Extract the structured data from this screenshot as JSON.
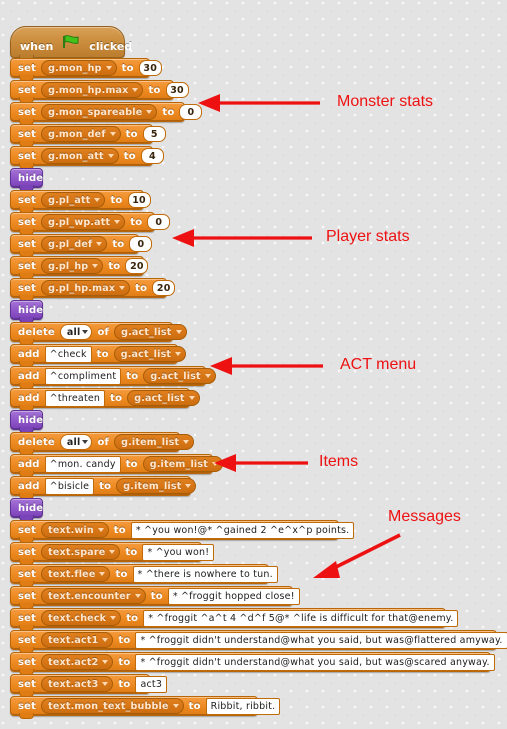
{
  "editor": {
    "background_color": "#e3e3e3",
    "annotation_color": "#ee1111",
    "data_block_color": "#ee8a22",
    "looks_block_color": "#8e55c8",
    "hat_block_color": "#c98b3b"
  },
  "hat": {
    "when_label": "when",
    "flag_label": "green-flag",
    "clicked_label": "clicked"
  },
  "keywords": {
    "set": "set",
    "to": "to",
    "hide": "hide",
    "delete": "delete",
    "of": "of",
    "add": "add"
  },
  "scripts": {
    "monster_stats": [
      {
        "op": "set",
        "variable": "g.mon_hp",
        "value": "30"
      },
      {
        "op": "set",
        "variable": "g.mon_hp.max",
        "value": "30"
      },
      {
        "op": "set",
        "variable": "g.mon_spareable",
        "value": "0"
      },
      {
        "op": "set",
        "variable": "g.mon_def",
        "value": "5"
      },
      {
        "op": "set",
        "variable": "g.mon_att",
        "value": "4"
      }
    ],
    "hide_1": "hide",
    "player_stats": [
      {
        "op": "set",
        "variable": "g.pl_att",
        "value": "10"
      },
      {
        "op": "set",
        "variable": "g.pl_wp.att",
        "value": "0"
      },
      {
        "op": "set",
        "variable": "g.pl_def",
        "value": "0"
      },
      {
        "op": "set",
        "variable": "g.pl_hp",
        "value": "20"
      },
      {
        "op": "set",
        "variable": "g.pl_hp.max",
        "value": "20"
      }
    ],
    "hide_2": "hide",
    "act_menu": [
      {
        "op": "delete",
        "selection": "all",
        "list": "g.act_list"
      },
      {
        "op": "add",
        "item": "^check",
        "list": "g.act_list"
      },
      {
        "op": "add",
        "item": "^compliment",
        "list": "g.act_list"
      },
      {
        "op": "add",
        "item": "^threaten",
        "list": "g.act_list"
      }
    ],
    "hide_3": "hide",
    "items": [
      {
        "op": "delete",
        "selection": "all",
        "list": "g.item_list"
      },
      {
        "op": "add",
        "item": "^mon. candy",
        "list": "g.item_list"
      },
      {
        "op": "add",
        "item": "^bisicle",
        "list": "g.item_list"
      }
    ],
    "hide_4": "hide",
    "messages": [
      {
        "op": "set",
        "variable": "text.win",
        "value": "* ^you won!@* ^gained 2 ^e^x^p points."
      },
      {
        "op": "set",
        "variable": "text.spare",
        "value": "* ^you won!"
      },
      {
        "op": "set",
        "variable": "text.flee",
        "value": "* ^there is nowhere to tun."
      },
      {
        "op": "set",
        "variable": "text.encounter",
        "value": "* ^froggit hopped close!"
      },
      {
        "op": "set",
        "variable": "text.check",
        "value": "* ^froggit ^a^t 4 ^d^f 5@* ^life is difficult for that@enemy."
      },
      {
        "op": "set",
        "variable": "text.act1",
        "value": "* ^froggit didn't understand@what you said, but was@flattered amyway."
      },
      {
        "op": "set",
        "variable": "text.act2",
        "value": "* ^froggit didn't understand@what you said, but was@scared anyway."
      },
      {
        "op": "set",
        "variable": "text.act3",
        "value": "act3"
      },
      {
        "op": "set",
        "variable": "text.mon_text_bubble",
        "value": "Ribbit, ribbit."
      }
    ]
  },
  "annotations": [
    {
      "label": "Monster stats"
    },
    {
      "label": "Player stats"
    },
    {
      "label": "ACT menu"
    },
    {
      "label": "Items"
    },
    {
      "label": "Messages"
    }
  ]
}
